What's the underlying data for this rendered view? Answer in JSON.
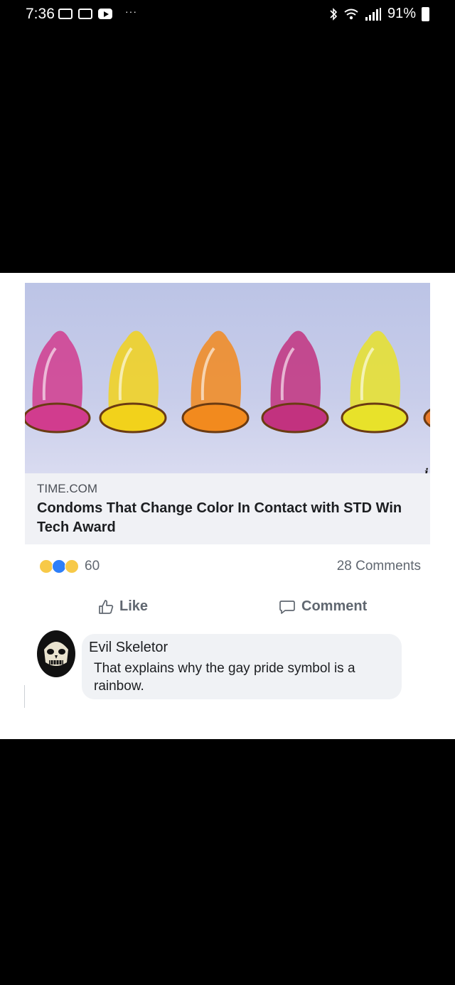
{
  "status_bar": {
    "time": "7:36",
    "battery": "91%",
    "more": "···"
  },
  "post": {
    "link": {
      "domain": "TIME.COM",
      "headline": "Condoms That Change Color In Contact with STD Win Tech Award",
      "image_colors": [
        "#d13c8e",
        "#f2d21b",
        "#f28a1e",
        "#c2327f",
        "#e8e22a",
        "#e97a2a"
      ]
    },
    "reactions": {
      "count": "60",
      "types": [
        "haha",
        "like",
        "wow"
      ]
    },
    "comments_count": "28 Comments",
    "actions": {
      "like": "Like",
      "comment": "Comment"
    },
    "comment": {
      "author": "Evil Skeletor",
      "text": "That explains why the gay pride symbol is a rainbow."
    }
  }
}
